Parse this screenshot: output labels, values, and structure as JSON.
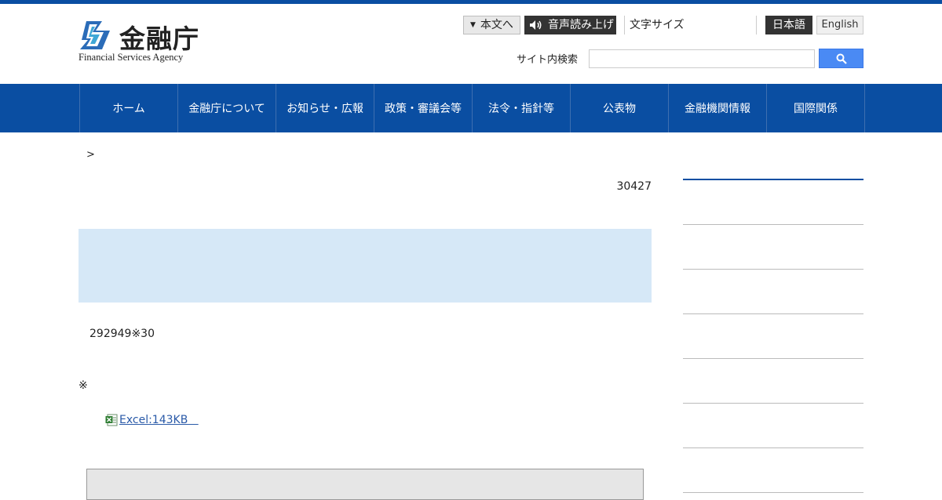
{
  "header": {
    "logo_title": "金融庁",
    "logo_subtitle": "Financial Services Agency",
    "skip_to_main": "本文へ",
    "read_aloud": "音声読み上げ",
    "text_size": "文字サイズ",
    "lang_japanese": "日本語",
    "lang_english": "English",
    "search_label": "サイト内検索",
    "search_value": "",
    "accent_color": "#0a4ea2"
  },
  "nav": {
    "items": [
      {
        "label": "ホーム"
      },
      {
        "label": "金融庁について"
      },
      {
        "label": "お知らせ・広報"
      },
      {
        "label": "政策・審議会等"
      },
      {
        "label": "法令・指針等"
      },
      {
        "label": "公表物"
      },
      {
        "label": "金融機関情報"
      },
      {
        "label": "国際関係"
      }
    ]
  },
  "main": {
    "breadcrumb": ">",
    "date": "30427",
    "paragraph": "292949※30",
    "note": "※",
    "file_link": "Excel:143KB   ",
    "panel_color": "#d6e8f7"
  },
  "icons": {
    "logo": "fsa-logo-mark",
    "voice": "speaker-icon",
    "search": "search-icon",
    "excel": "excel-icon"
  }
}
